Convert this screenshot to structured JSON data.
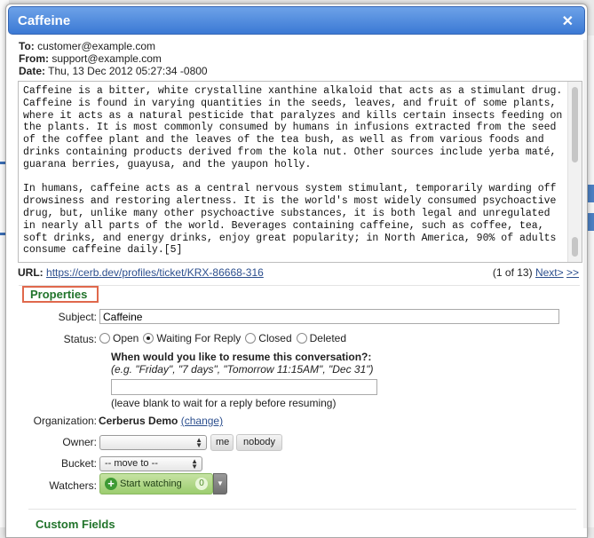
{
  "dialog": {
    "title": "Caffeine",
    "close_icon": "close-icon"
  },
  "headers": {
    "to_label": "To:",
    "to": "customer@example.com",
    "from_label": "From:",
    "from": "support@example.com",
    "date_label": "Date:",
    "date": "Thu, 13 Dec 2012 05:27:34 -0800"
  },
  "message": {
    "paragraph1": "Caffeine is a bitter, white crystalline xanthine alkaloid that acts as a stimulant drug. Caffeine is found in varying quantities in the seeds, leaves, and fruit of some plants, where it acts as a natural pesticide that paralyzes and kills certain insects feeding on the plants. It is most commonly consumed by humans in infusions extracted from the seed of the coffee plant and the leaves of the tea bush, as well as from various foods and drinks containing products derived from the kola nut. Other sources include yerba maté, guarana berries, guayusa, and the yaupon holly.",
    "paragraph2": "In humans, caffeine acts as a central nervous system stimulant, temporarily warding off drowsiness and restoring alertness. It is the world's most widely consumed psychoactive drug, but, unlike many other psychoactive substances, it is both legal and unregulated in nearly all parts of the world. Beverages containing caffeine, such as coffee, tea, soft drinks, and energy drinks, enjoy great popularity; in North America, 90% of adults consume caffeine daily.[5]"
  },
  "url_row": {
    "label": "URL:",
    "url": "https://cerb.dev/profiles/ticket/KRX-86668-316",
    "pager_text": "(1 of 13)",
    "next_label": "Next>",
    "last_label": ">>"
  },
  "properties": {
    "section_title": "Properties",
    "subject_label": "Subject:",
    "subject_value": "Caffeine",
    "status_label": "Status:",
    "status_options": [
      "Open",
      "Waiting For Reply",
      "Closed",
      "Deleted"
    ],
    "status_selected": "Waiting For Reply",
    "resume_question": "When would you like to resume this conversation?:",
    "resume_examples": "(e.g. \"Friday\", \"7 days\", \"Tomorrow 11:15AM\", \"Dec 31\")",
    "resume_value": "",
    "resume_hint": "(leave blank to wait for a reply before resuming)",
    "organization_label": "Organization:",
    "organization_value": "Cerberus Demo",
    "organization_change": "(change)",
    "owner_label": "Owner:",
    "owner_value": "",
    "owner_me": "me",
    "owner_nobody": "nobody",
    "bucket_label": "Bucket:",
    "bucket_value": "-- move to --",
    "watchers_label": "Watchers:",
    "watch_button": "Start watching",
    "watch_count": "0"
  },
  "custom_fields": {
    "section_title": "Custom Fields"
  }
}
